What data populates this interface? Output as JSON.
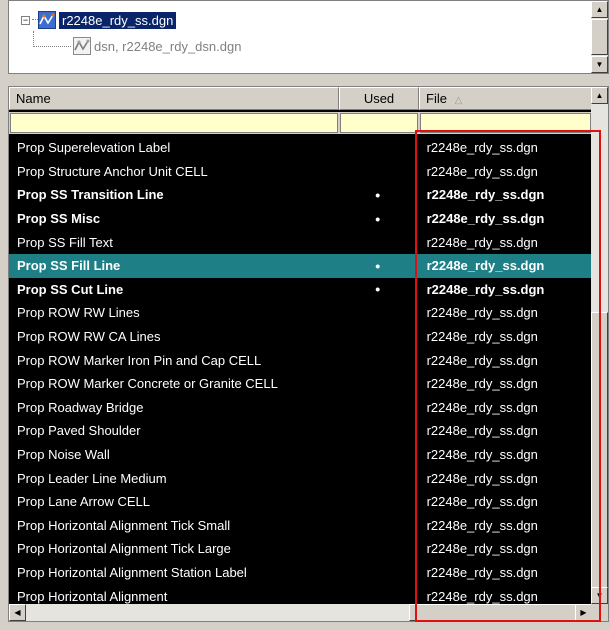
{
  "tree": {
    "root": {
      "expander": "−",
      "label": "r2248e_rdy_ss.dgn",
      "icon": "dgn-file-icon"
    },
    "child": {
      "label": "dsn, r2248e_rdy_dsn.dgn",
      "icon": "dgn-file-icon"
    }
  },
  "columns": {
    "name": "Name",
    "used": "Used",
    "file": "File",
    "file_sort_indicator": "△"
  },
  "used_marker": "•",
  "rows": [
    {
      "name": "Prop Superelevation Label",
      "used": "",
      "file": "r2248e_rdy_ss.dgn",
      "bold": false,
      "selected": false
    },
    {
      "name": "Prop Structure Anchor Unit CELL",
      "used": "",
      "file": "r2248e_rdy_ss.dgn",
      "bold": false,
      "selected": false
    },
    {
      "name": "Prop SS Transition Line",
      "used": "•",
      "file": "r2248e_rdy_ss.dgn",
      "bold": true,
      "selected": false
    },
    {
      "name": "Prop SS Misc",
      "used": "•",
      "file": "r2248e_rdy_ss.dgn",
      "bold": true,
      "selected": false
    },
    {
      "name": "Prop SS Fill Text",
      "used": "",
      "file": "r2248e_rdy_ss.dgn",
      "bold": false,
      "selected": false
    },
    {
      "name": "Prop SS Fill Line",
      "used": "•",
      "file": "r2248e_rdy_ss.dgn",
      "bold": true,
      "selected": true
    },
    {
      "name": "Prop SS Cut Line",
      "used": "•",
      "file": "r2248e_rdy_ss.dgn",
      "bold": true,
      "selected": false
    },
    {
      "name": "Prop ROW RW Lines",
      "used": "",
      "file": "r2248e_rdy_ss.dgn",
      "bold": false,
      "selected": false
    },
    {
      "name": "Prop ROW RW CA Lines",
      "used": "",
      "file": "r2248e_rdy_ss.dgn",
      "bold": false,
      "selected": false
    },
    {
      "name": "Prop ROW Marker Iron Pin and Cap CELL",
      "used": "",
      "file": "r2248e_rdy_ss.dgn",
      "bold": false,
      "selected": false
    },
    {
      "name": "Prop ROW Marker Concrete or Granite CELL",
      "used": "",
      "file": "r2248e_rdy_ss.dgn",
      "bold": false,
      "selected": false
    },
    {
      "name": "Prop Roadway Bridge",
      "used": "",
      "file": "r2248e_rdy_ss.dgn",
      "bold": false,
      "selected": false
    },
    {
      "name": "Prop Paved Shoulder",
      "used": "",
      "file": "r2248e_rdy_ss.dgn",
      "bold": false,
      "selected": false
    },
    {
      "name": "Prop Noise Wall",
      "used": "",
      "file": "r2248e_rdy_ss.dgn",
      "bold": false,
      "selected": false
    },
    {
      "name": "Prop Leader Line Medium",
      "used": "",
      "file": "r2248e_rdy_ss.dgn",
      "bold": false,
      "selected": false
    },
    {
      "name": "Prop Lane Arrow CELL",
      "used": "",
      "file": "r2248e_rdy_ss.dgn",
      "bold": false,
      "selected": false
    },
    {
      "name": "Prop Horizontal Alignment Tick Small",
      "used": "",
      "file": "r2248e_rdy_ss.dgn",
      "bold": false,
      "selected": false
    },
    {
      "name": "Prop Horizontal Alignment Tick Large",
      "used": "",
      "file": "r2248e_rdy_ss.dgn",
      "bold": false,
      "selected": false
    },
    {
      "name": "Prop Horizontal Alignment Station Label",
      "used": "",
      "file": "r2248e_rdy_ss.dgn",
      "bold": false,
      "selected": false
    },
    {
      "name": "Prop Horizontal Alignment",
      "used": "",
      "file": "r2248e_rdy_ss.dgn",
      "bold": false,
      "selected": false
    }
  ],
  "scroll": {
    "up": "▲",
    "down": "▼",
    "left": "◀",
    "right": "▶"
  },
  "colors": {
    "list_background": "#000000",
    "selected_row": "#1e7f86",
    "filter_row": "#ffffcc",
    "tree_selection": "#0a246a",
    "annotation_box": "#e01010"
  }
}
